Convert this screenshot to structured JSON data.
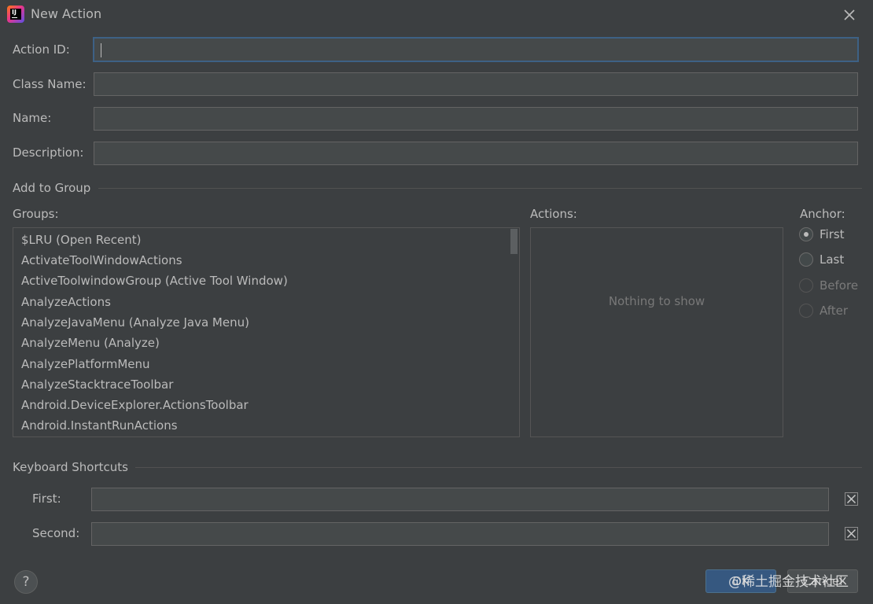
{
  "window": {
    "title": "New Action",
    "icon": "intellij-idea-icon",
    "icon_text": "IJ"
  },
  "form": {
    "action_id": {
      "label": "Action ID:",
      "value": ""
    },
    "class_name": {
      "label": "Class Name:",
      "value": ""
    },
    "name": {
      "label": "Name:",
      "value": ""
    },
    "description": {
      "label": "Description:",
      "value": ""
    }
  },
  "add_to_group": {
    "section_title": "Add to Group",
    "groups_label": "Groups:",
    "groups": [
      "$LRU (Open Recent)",
      "ActivateToolWindowActions",
      "ActiveToolwindowGroup (Active Tool Window)",
      "AnalyzeActions",
      "AnalyzeJavaMenu (Analyze Java Menu)",
      "AnalyzeMenu (Analyze)",
      "AnalyzePlatformMenu",
      "AnalyzeStacktraceToolbar",
      "Android.DeviceExplorer.ActionsToolbar",
      "Android.InstantRunActions"
    ],
    "actions_label": "Actions:",
    "actions_empty": "Nothing to show",
    "anchor_label": "Anchor:",
    "anchor_options": [
      {
        "label": "First",
        "checked": true,
        "enabled": true
      },
      {
        "label": "Last",
        "checked": false,
        "enabled": true
      },
      {
        "label": "Before",
        "checked": false,
        "enabled": false
      },
      {
        "label": "After",
        "checked": false,
        "enabled": false
      }
    ]
  },
  "shortcuts": {
    "section_title": "Keyboard Shortcuts",
    "first": {
      "label": "First:",
      "value": ""
    },
    "second": {
      "label": "Second:",
      "value": ""
    }
  },
  "footer": {
    "help": "?",
    "ok": "OK",
    "cancel": "Cancel",
    "watermark": "@稀土掘金技术社区"
  },
  "colors": {
    "background": "#3c3f41",
    "field": "#45494a",
    "focus_border": "#3d6185",
    "ok_button": "#365880",
    "text": "#bbbbbb"
  }
}
